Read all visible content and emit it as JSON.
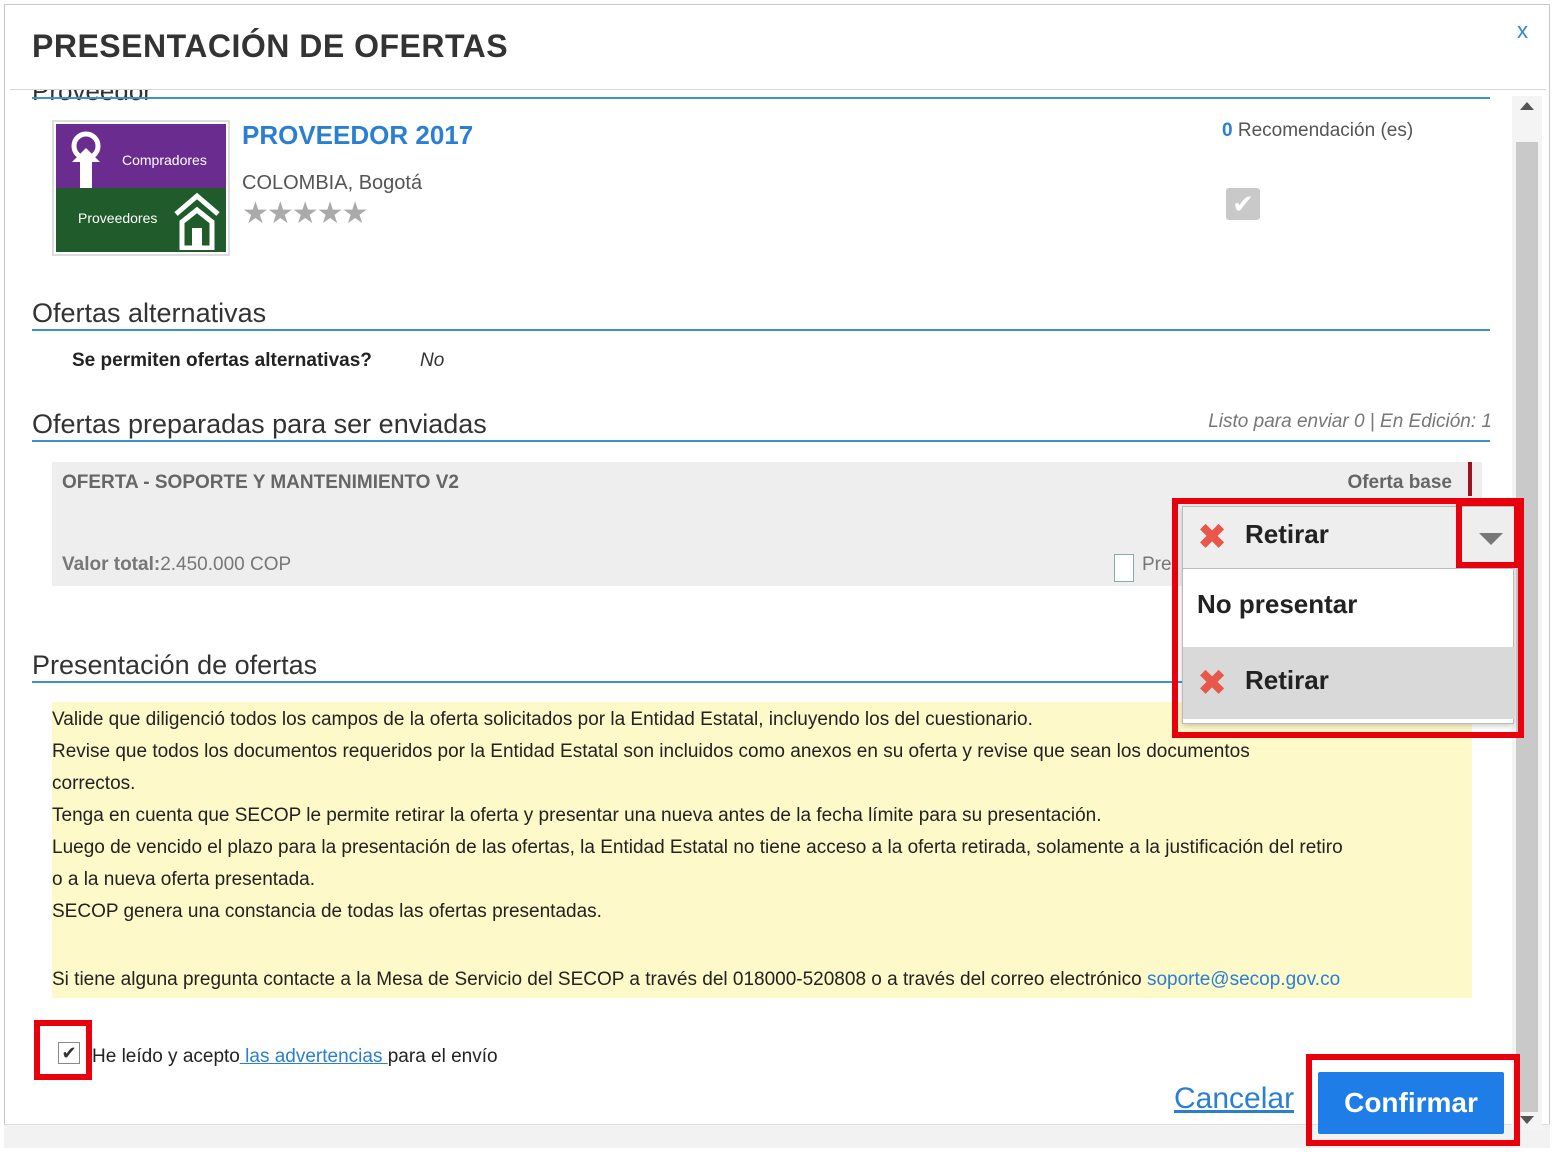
{
  "dialog": {
    "title": "PRESENTACIÓN DE OFERTAS",
    "close_label": "x",
    "cut_heading": "Proveedor"
  },
  "supplier": {
    "logo_text_top": "Compradores",
    "logo_text_bottom": "Proveedores",
    "name": "PROVEEDOR 2017",
    "location": "COLOMBIA, Bogotá",
    "rating_stars": "★★★★★",
    "recommendations_count": "0",
    "recommendations_label": "Recomendación (es)",
    "check_glyph": "✔"
  },
  "alternatives": {
    "title": "Ofertas alternativas",
    "question": "Se permiten ofertas alternativas?",
    "answer": "No"
  },
  "prepared": {
    "title": "Ofertas preparadas para ser enviadas",
    "status": "Listo para enviar 0 | En Edición: 1",
    "offer": {
      "name": "OFERTA - SOPORTE Y MANTENIMIENTO V2",
      "type": "Oferta base",
      "value_label": "Valor total:",
      "value": "2.450.000 COP",
      "doc_text": "Pre"
    }
  },
  "dropdown": {
    "selected": "Retirar",
    "options": [
      "No presentar",
      "Retirar"
    ],
    "x_glyph": "✖"
  },
  "presentation": {
    "title": "Presentación de ofertas",
    "lines": [
      "Valide que diligenció todos los campos de la oferta solicitados por la Entidad Estatal, incluyendo los del cuestionario.",
      "Revise que todos los documentos requeridos por la Entidad Estatal son incluidos como anexos en su oferta y revise que sean los documentos",
      "correctos.",
      "Tenga en cuenta que SECOP le permite retirar la oferta y presentar una nueva antes de la fecha límite para su presentación.",
      "Luego de vencido el plazo para la presentación de las ofertas, la Entidad Estatal no tiene acceso a la oferta retirada, solamente a la  justificación del retiro",
      "o a la nueva oferta presentada.",
      "SECOP genera una constancia de todas las ofertas presentadas."
    ],
    "contact_text": "Si tiene alguna pregunta contacte a la Mesa de Servicio del SECOP a través del 018000-520808 o a través del correo electrónico ",
    "contact_email": "soporte@secop.gov.co"
  },
  "accept": {
    "checked_glyph": "✔",
    "prefix": "He leído y acepto",
    "link": " las advertencias ",
    "suffix": "para el envío"
  },
  "actions": {
    "cancel": "Cancelar",
    "confirm": "Confirmar"
  }
}
